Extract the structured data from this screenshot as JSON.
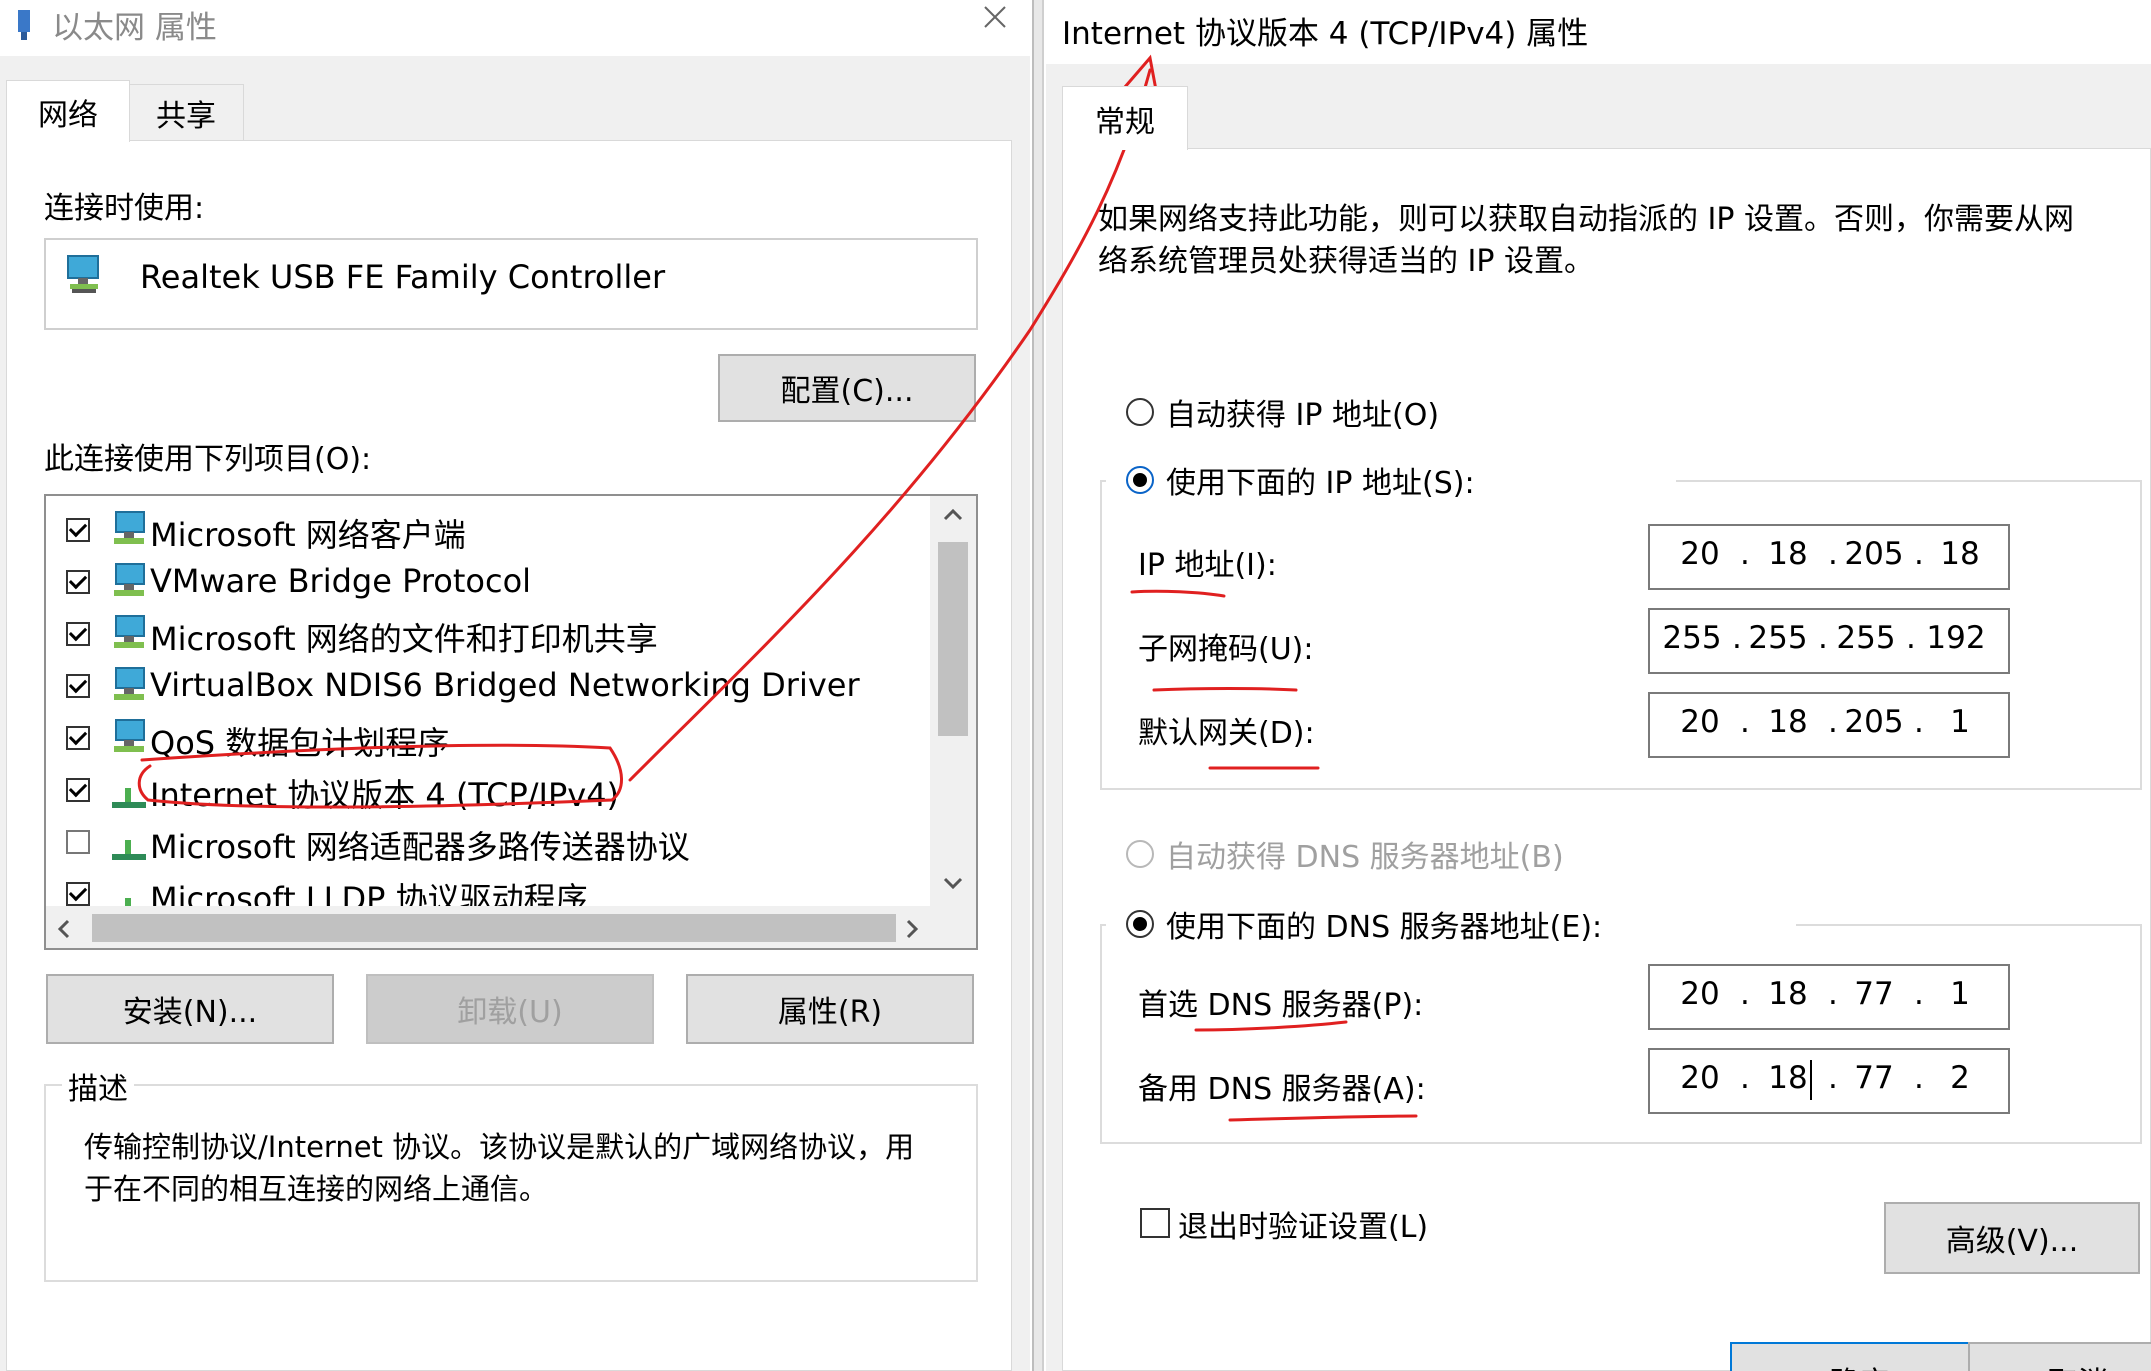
{
  "left_window": {
    "title": "以太网 属性",
    "tabs": [
      "网络",
      "共享"
    ],
    "connect_using_label": "连接时使用:",
    "adapter_name": "Realtek USB FE Family Controller",
    "configure_button": "配置(C)...",
    "items_label": "此连接使用下列项目(O):",
    "items": [
      {
        "label": "Microsoft 网络客户端",
        "checked": true,
        "icon": "network-client-icon"
      },
      {
        "label": "VMware Bridge Protocol",
        "checked": true,
        "icon": "network-client-icon"
      },
      {
        "label": "Microsoft 网络的文件和打印机共享",
        "checked": true,
        "icon": "network-client-icon"
      },
      {
        "label": "VirtualBox NDIS6 Bridged Networking Driver",
        "checked": true,
        "icon": "network-client-icon"
      },
      {
        "label": "QoS 数据包计划程序",
        "checked": true,
        "icon": "network-client-icon"
      },
      {
        "label": "Internet 协议版本 4 (TCP/IPv4)",
        "checked": true,
        "icon": "protocol-icon"
      },
      {
        "label": "Microsoft 网络适配器多路传送器协议",
        "checked": false,
        "icon": "protocol-icon"
      },
      {
        "label": "Microsoft LLDP 协议驱动程序",
        "checked": true,
        "icon": "protocol-icon"
      }
    ],
    "install_button": "安装(N)...",
    "uninstall_button": "卸载(U)",
    "properties_button": "属性(R)",
    "description_label": "描述",
    "description_text_line1": "传输控制协议/Internet 协议。该协议是默认的广域网络协议，用",
    "description_text_line2": "于在不同的相互连接的网络上通信。"
  },
  "right_window": {
    "title": "Internet 协议版本 4 (TCP/IPv4) 属性",
    "tab": "常规",
    "intro_line1": "如果网络支持此功能，则可以获取自动指派的 IP 设置。否则，你需要从网",
    "intro_line2": "络系统管理员处获得适当的 IP 设置。",
    "auto_ip_label": "自动获得 IP 地址(O)",
    "manual_ip_label": "使用下面的 IP 地址(S):",
    "ip_label": "IP 地址(I):",
    "ip": [
      "20",
      "18",
      "205",
      "18"
    ],
    "mask_label": "子网掩码(U):",
    "mask": [
      "255",
      "255",
      "255",
      "192"
    ],
    "gateway_label": "默认网关(D):",
    "gateway": [
      "20",
      "18",
      "205",
      "1"
    ],
    "auto_dns_label": "自动获得 DNS 服务器地址(B)",
    "manual_dns_label": "使用下面的 DNS 服务器地址(E):",
    "preferred_dns_label": "首选 DNS 服务器(P):",
    "preferred_dns": [
      "20",
      "18",
      "77",
      "1"
    ],
    "alternate_dns_label": "备用 DNS 服务器(A):",
    "alternate_dns": [
      "20",
      "18",
      "77",
      "2"
    ],
    "validate_label": "退出时验证设置(L)",
    "advanced_button": "高级(V)...",
    "ok_button": "确定",
    "cancel_button": "取消"
  },
  "colors": {
    "annotation": "#e02020",
    "dialog_bg": "#f0f0f0"
  }
}
